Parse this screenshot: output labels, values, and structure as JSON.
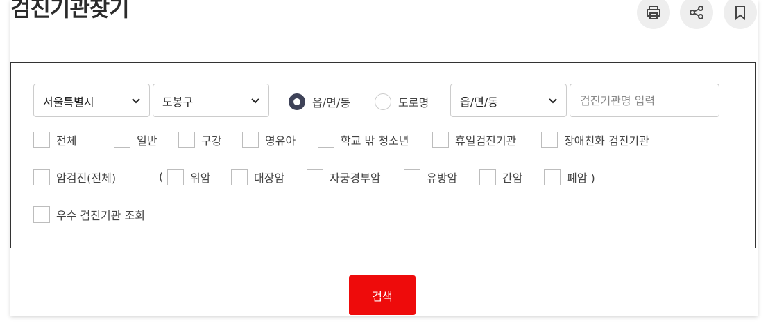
{
  "page_title": "검진기관찾기",
  "tools": {
    "print_icon": "print-icon",
    "share_icon": "share-icon",
    "bookmark_icon": "bookmark-icon"
  },
  "filters": {
    "region_select": "서울특별시",
    "district_select": "도봉구",
    "address_type": {
      "options": [
        "읍/면/동",
        "도로명"
      ],
      "selected": "읍/면/동"
    },
    "dong_select": "읍/면/동",
    "name_input": {
      "value": "",
      "placeholder": "검진기관명 입력"
    },
    "row1": [
      "전체",
      "일반",
      "구강",
      "영유아",
      "학교 밖 청소년",
      "휴일검진기관",
      "장애친화 검진기관"
    ],
    "row2": {
      "cancer_all": "암검진(전체)",
      "open_paren": "(",
      "items": [
        "위암",
        "대장암",
        "자궁경부암",
        "유방암",
        "간암",
        "폐암 )"
      ]
    },
    "row3": [
      "우수 검진기관 조회"
    ]
  },
  "search_button": "검색",
  "colors": {
    "accent_red": "#ee0b0b",
    "radio_selected": "#3e4258",
    "border": "#cccccc"
  }
}
